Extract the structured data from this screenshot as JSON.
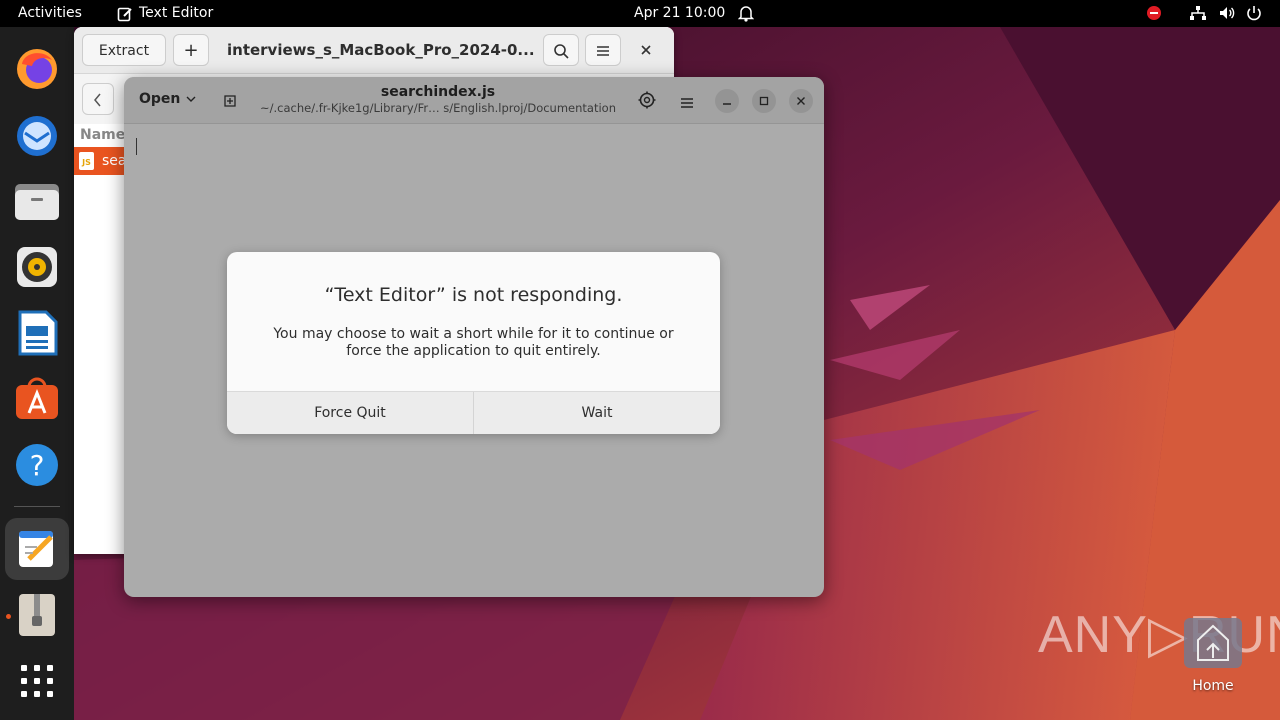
{
  "topbar": {
    "activities": "Activities",
    "app_name": "Text Editor",
    "clock": "Apr 21  10:00"
  },
  "dock": {
    "items": [
      {
        "name": "Firefox",
        "icon": "firefox-icon"
      },
      {
        "name": "Thunderbird",
        "icon": "thunderbird-icon"
      },
      {
        "name": "Files",
        "icon": "files-icon"
      },
      {
        "name": "Rhythmbox",
        "icon": "rhythmbox-icon"
      },
      {
        "name": "LibreOffice Writer",
        "icon": "writer-icon"
      },
      {
        "name": "App Center",
        "icon": "app-center-icon"
      },
      {
        "name": "Help",
        "icon": "help-icon"
      },
      {
        "name": "Text Editor",
        "icon": "text-editor-icon"
      },
      {
        "name": "Archive Manager",
        "icon": "archive-manager-icon"
      },
      {
        "name": "Show Applications",
        "icon": "app-grid-icon"
      }
    ]
  },
  "archive_window": {
    "extract_label": "Extract",
    "title": "interviews_s_MacBook_Pro_2024-0...",
    "column_name": "Name",
    "row_label": "sea"
  },
  "editor": {
    "open_label": "Open",
    "doc_title": "searchindex.js",
    "doc_path": "~/.cache/.fr-Kjke1g/Library/Fr… s/English.lproj/Documentation"
  },
  "dialog": {
    "title": "“Text Editor” is not responding.",
    "body_line1": "You may choose to wait a short while for it to continue or",
    "body_line2": "force the application to quit entirely.",
    "force_quit_label": "Force Quit",
    "wait_label": "Wait"
  },
  "desktop": {
    "watermark": "ANY▷RUN",
    "home_label": "Home"
  },
  "colors": {
    "accent": "#e95420",
    "topbar": "#000000",
    "dock": "#1e1e1e",
    "dialog_bg": "#fafafa"
  }
}
